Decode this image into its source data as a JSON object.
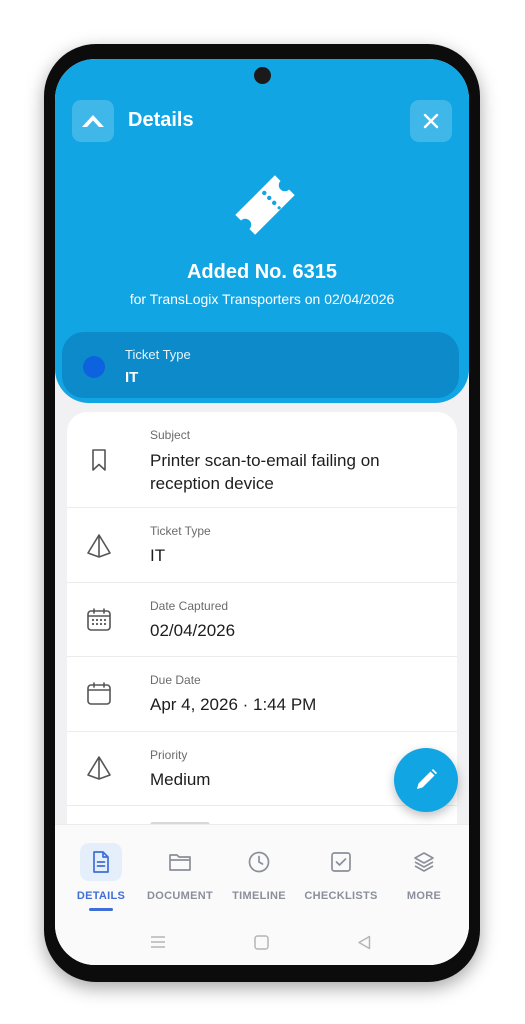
{
  "header": {
    "title": "Details",
    "added_title": "Added No. 6315",
    "added_subtitle": "for TransLogix Transporters on 02/04/2026",
    "brand_color": "#11a5e4"
  },
  "type_card": {
    "label": "Ticket Type",
    "value": "IT"
  },
  "details": [
    {
      "label": "Subject",
      "value": "Printer scan-to-email failing on reception device",
      "icon": "bookmark-icon"
    },
    {
      "label": "Ticket Type",
      "value": "IT",
      "icon": "priority-diamond-icon"
    },
    {
      "label": "Date Captured",
      "value": "02/04/2026",
      "icon": "calendar-grid-icon"
    },
    {
      "label": "Due Date",
      "value": "Apr 4, 2026 · 1:44 PM",
      "icon": "calendar-icon"
    },
    {
      "label": "Priority",
      "value": "Medium",
      "icon": "priority-diamond-icon"
    }
  ],
  "fab": {
    "icon": "pencil-icon"
  },
  "bottom_nav": {
    "tabs": [
      {
        "label": "DETAILS",
        "icon": "document-icon",
        "active": true
      },
      {
        "label": "DOCUMENT",
        "icon": "folder-icon",
        "active": false
      },
      {
        "label": "TIMELINE",
        "icon": "clock-icon",
        "active": false
      },
      {
        "label": "CHECKLISTS",
        "icon": "checkbox-icon",
        "active": false
      },
      {
        "label": "MORE",
        "icon": "layers-icon",
        "active": false
      }
    ]
  }
}
